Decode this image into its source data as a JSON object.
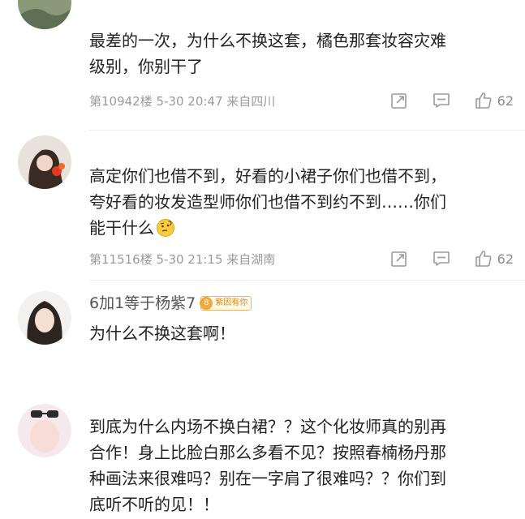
{
  "comments": [
    {
      "text_lines": [
        "最差的一次，为什么不换这套，橘色那套妆容灾难",
        "级别，你别干了"
      ],
      "meta": "第10942楼 5-30 20:47 来自四川",
      "likes": "62",
      "avatar_icon": "avatar-landscape-icon"
    },
    {
      "text_lines": [
        "高定你们也借不到，好看的小裙子你们也借不到，",
        "夸好看的妆发造型师你们也借不到约不到……你们",
        "能干什么"
      ],
      "meta": "第11516楼 5-30 21:15 来自湖南",
      "likes": "62",
      "emoji": "thinking-face-icon",
      "avatar_icon": "avatar-girl-icon"
    },
    {
      "username": "6加1等于杨紫7",
      "badge_level": "8",
      "badge_label": "紫因有你",
      "text_lines": [
        "为什么不换这套啊！"
      ],
      "avatar_icon": "avatar-portrait-icon"
    },
    {
      "text_lines": [
        "到底为什么内场不换白裙？？这个化妆师真的别再",
        "合作！身上比脸白那么多看不见？按照春楠杨丹那",
        "种画法来很难吗？别在一字肩了很难吗？？你们到",
        "底听不听的见！！"
      ],
      "avatar_icon": "avatar-sunglasses-icon"
    }
  ],
  "colors": {
    "text": "#222222",
    "meta": "#9a9a9a",
    "badge": "#f2a93b"
  }
}
